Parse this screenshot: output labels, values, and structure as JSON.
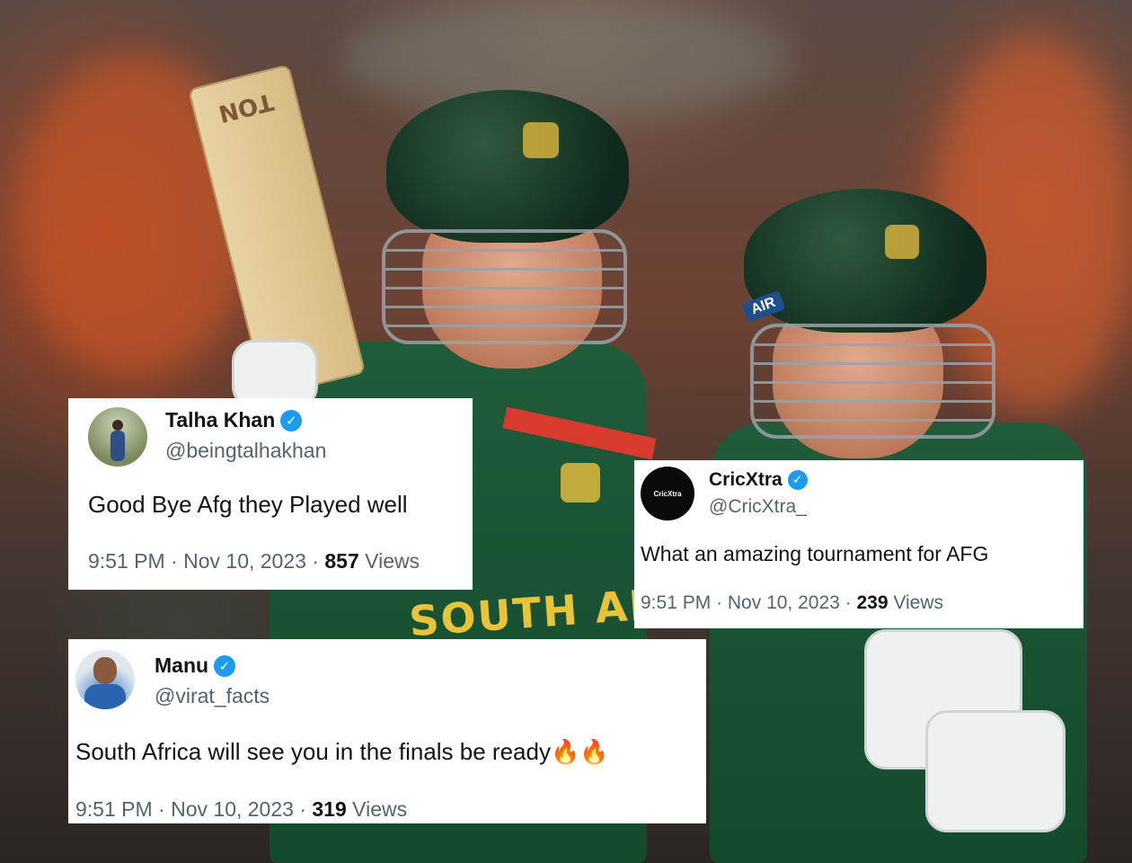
{
  "background": {
    "bat_brand": "TON",
    "helmet_sponsor": "AIR",
    "jersey_text": "SOUTH AFRICA"
  },
  "colors": {
    "verified": "#1d9bf0",
    "text_primary": "#0f1419",
    "text_secondary": "#536471"
  },
  "tweets": [
    {
      "name": "Talha Khan",
      "handle": "@beingtalhakhan",
      "text": "Good Bye Afg they Played well",
      "time": "9:51 PM",
      "date": "Nov 10, 2023",
      "views": "857",
      "views_label": "Views",
      "verified_icon": "verified-badge-icon"
    },
    {
      "name": "CricXtra",
      "handle": "@CricXtra_",
      "text": "What an amazing tournament for AFG",
      "time": "9:51 PM",
      "date": "Nov 10, 2023",
      "views": "239",
      "views_label": "Views",
      "avatar_text": "CricXtra",
      "verified_icon": "verified-badge-icon"
    },
    {
      "name": "Manu",
      "handle": "@virat_facts",
      "text": "South Africa will see you in the finals be ready",
      "emoji": "🔥🔥",
      "time": "9:51 PM",
      "date": "Nov 10, 2023",
      "views": "319",
      "views_label": "Views",
      "verified_icon": "verified-badge-icon"
    }
  ]
}
